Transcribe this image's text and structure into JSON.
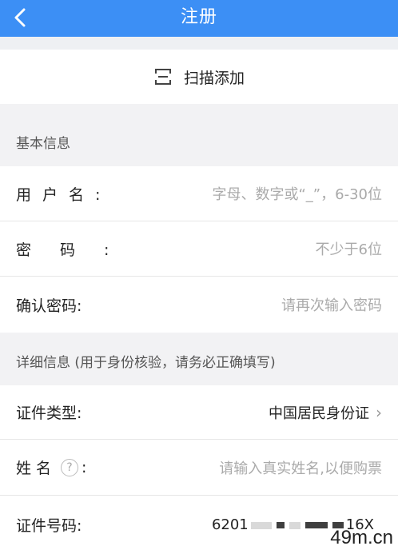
{
  "nav": {
    "title": "注册"
  },
  "scan": {
    "label": "扫描添加"
  },
  "sections": {
    "basic": "基本信息",
    "detail": "详细信息 (用于身份核验，请务必正确填写)"
  },
  "fields": {
    "username": {
      "label": "用户名:",
      "placeholder": "字母、数字或“_”，6-30位"
    },
    "password": {
      "label": "密码:",
      "placeholder": "不少于6位"
    },
    "confirm": {
      "label": "确认密码:",
      "placeholder": "请再次输入密码"
    },
    "id_type": {
      "label": "证件类型:",
      "value": "中国居民身份证"
    },
    "name": {
      "label": "姓名",
      "suffix": ":",
      "placeholder": "请输入真实姓名,以便购票"
    },
    "id_number": {
      "label": "证件号码:",
      "value_start": "6201",
      "value_end": "16X"
    }
  },
  "icons": [
    "back-arrow-icon",
    "scan-icon",
    "help-icon",
    "chevron-right-icon"
  ],
  "colors": {
    "nav": "#3c8ff5",
    "background": "#f2f2f4",
    "placeholder": "#aaaaaa"
  },
  "watermark": "49m.cn"
}
